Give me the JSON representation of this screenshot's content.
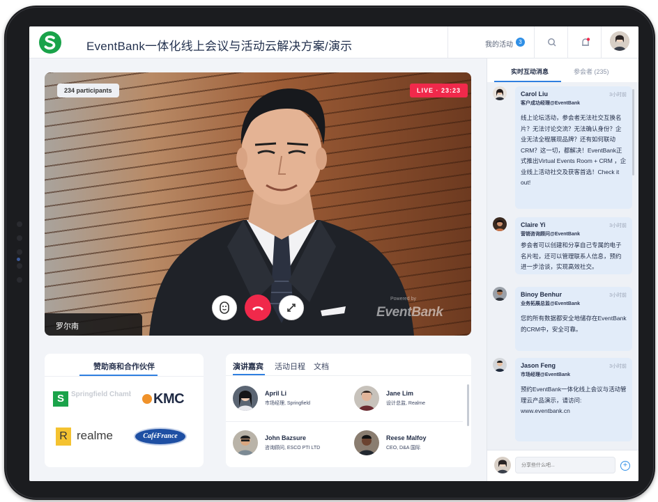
{
  "header": {
    "title": "EventBank一体化线上会议与活动云解决方案/演示",
    "my_activity_label": "我的活动",
    "my_activity_count": "3"
  },
  "video": {
    "participants": "234 participants",
    "live": "LIVE · 23:23",
    "speaker_name": "罗尔南",
    "watermark": "EventBank",
    "watermark_prefix": "Powered by"
  },
  "sponsors": {
    "title": "赞助商和合作伙伴",
    "logos": [
      {
        "name": "Springfield Chamber of Commerce",
        "text": "Springfield Chamber of Comm"
      },
      {
        "name": "KMC",
        "text": "KMC"
      },
      {
        "name": "realme",
        "text": "realme"
      },
      {
        "name": "CaféFrance",
        "text": "CaféFrance"
      }
    ]
  },
  "speakers": {
    "tabs": [
      "演讲嘉宾",
      "活动日程",
      "文档"
    ],
    "active_tab": 0,
    "items": [
      {
        "name": "April Li",
        "role": "市场经理, Springfield"
      },
      {
        "name": "Jane Lim",
        "role": "设计总监, Realme"
      },
      {
        "name": "John Bazsure",
        "role": "咨询顾问, ESCO PTI LTD"
      },
      {
        "name": "Reese Malfoy",
        "role": "CEO, D&A 国际"
      }
    ]
  },
  "chat": {
    "tabs": [
      "实时互动消息",
      "参会者 (235)"
    ],
    "messages": [
      {
        "name": "Carol Liu",
        "role": "客户成功经理@EventBank",
        "time": "3小时前",
        "text": "线上论坛活动，参会者无法社交互换名片？无法讨论交流？无法确认身份？企业无法全程展现品牌？还有如何联动CRM？这一切，都解决！EventBank正式推出Virtual Events Room + CRM ，企业线上活动社交及获客首选！Check it out!"
      },
      {
        "name": "Claire Yi",
        "role": "营销咨询顾问@EventBank",
        "time": "3小时前",
        "text": "参会者可以创建和分享自己专属的电子名片啦，还可以管理联系人信息，预约进一步洽谈，实现高效社交。"
      },
      {
        "name": "Binoy Benhur",
        "role": "业务拓展总监@EventBank",
        "time": "3小时前",
        "text": "您的所有数据都安全地储存在EventBank的CRM中，安全可靠。"
      },
      {
        "name": "Jason Feng",
        "role": "市场经理@EventBank",
        "time": "3小时前",
        "text": "预约EventBank一体化线上会议与活动管理云产品演示，请访问: www.eventbank.cn"
      }
    ],
    "input_placeholder": "分享些什么吧..."
  },
  "icons": {
    "logo": "eventbank-s-logo",
    "search": "search-icon",
    "notifications": "bell-icon",
    "emoji": "emoji-icon",
    "hangup": "phone-hangup-icon",
    "fullscreen": "expand-icon",
    "send": "plus-circle-icon"
  },
  "colors": {
    "accent": "#2f7fe0",
    "live": "#f0294b",
    "brand_green": "#1aa34a"
  }
}
